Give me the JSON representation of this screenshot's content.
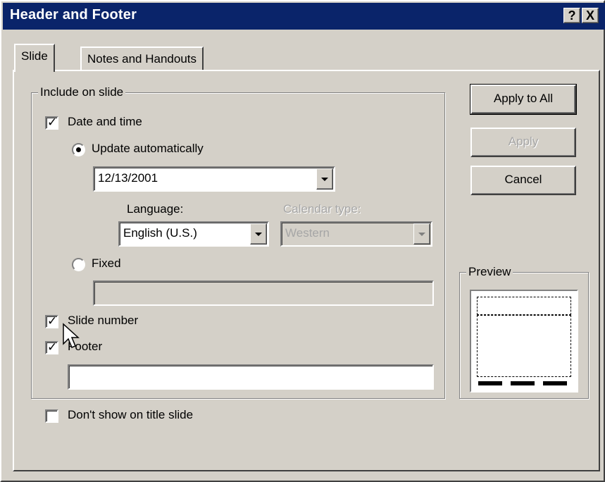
{
  "window": {
    "title": "Header and Footer",
    "help_button": "?",
    "close_button": "X"
  },
  "tabs": [
    {
      "label": "Slide",
      "active": true
    },
    {
      "label": "Notes and Handouts",
      "active": false
    }
  ],
  "include_group": {
    "legend": "Include on slide",
    "date_time": {
      "label": "Date and time",
      "checked": true
    },
    "update_automatically": {
      "label": "Update automatically",
      "selected": true
    },
    "date_value": "12/13/2001",
    "language": {
      "label": "Language:",
      "value": "English (U.S.)"
    },
    "calendar_type": {
      "label": "Calendar type:",
      "value": "Western",
      "disabled": true
    },
    "fixed": {
      "label": "Fixed",
      "selected": false,
      "value": ""
    },
    "slide_number": {
      "label": "Slide number",
      "checked": true
    },
    "footer": {
      "label": "Footer",
      "checked": true,
      "value": ""
    }
  },
  "dont_show_title": {
    "label": "Don't show on title slide",
    "checked": false
  },
  "buttons": {
    "apply_all": "Apply to All",
    "apply": "Apply",
    "cancel": "Cancel"
  },
  "preview": {
    "legend": "Preview"
  },
  "colors": {
    "titlebar": "#0a246a",
    "face": "#d4d0c8"
  }
}
